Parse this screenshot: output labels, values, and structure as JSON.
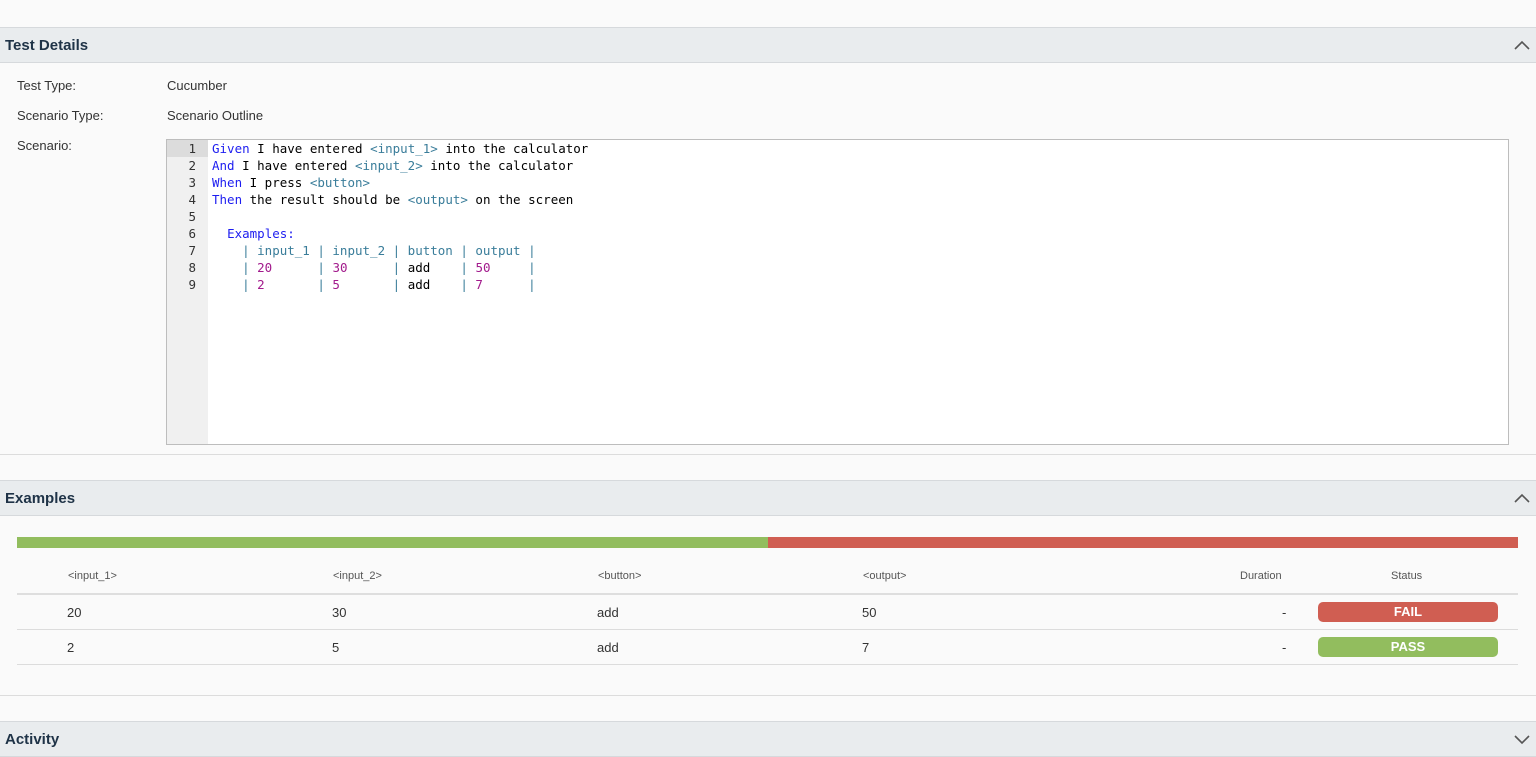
{
  "test_details": {
    "title": "Test Details",
    "test_type_label": "Test Type:",
    "test_type_value": "Cucumber",
    "scenario_type_label": "Scenario Type:",
    "scenario_type_value": "Scenario Outline",
    "scenario_label": "Scenario:"
  },
  "editor": {
    "lines": [
      {
        "n": "1",
        "segments": [
          {
            "t": "Given",
            "c": "kw"
          },
          {
            "t": " I have entered ",
            "c": ""
          },
          {
            "t": "<input_1>",
            "c": "ph"
          },
          {
            "t": " into the calculator",
            "c": ""
          }
        ]
      },
      {
        "n": "2",
        "segments": [
          {
            "t": "And",
            "c": "kw"
          },
          {
            "t": " I have entered ",
            "c": ""
          },
          {
            "t": "<input_2>",
            "c": "ph"
          },
          {
            "t": " into the calculator",
            "c": ""
          }
        ]
      },
      {
        "n": "3",
        "segments": [
          {
            "t": "When",
            "c": "kw"
          },
          {
            "t": " I press ",
            "c": ""
          },
          {
            "t": "<button>",
            "c": "ph"
          }
        ]
      },
      {
        "n": "4",
        "segments": [
          {
            "t": "Then",
            "c": "kw"
          },
          {
            "t": " the result should be ",
            "c": ""
          },
          {
            "t": "<output>",
            "c": "ph"
          },
          {
            "t": " on the screen",
            "c": ""
          }
        ]
      },
      {
        "n": "5",
        "segments": []
      },
      {
        "n": "6",
        "segments": [
          {
            "t": "  ",
            "c": ""
          },
          {
            "t": "Examples:",
            "c": "kw"
          }
        ]
      },
      {
        "n": "7",
        "segments": [
          {
            "t": "    | input_1 | input_2 | button | output |",
            "c": "pipe"
          }
        ]
      },
      {
        "n": "8",
        "segments": [
          {
            "t": "    | ",
            "c": "pipe"
          },
          {
            "t": "20",
            "c": "num"
          },
          {
            "t": "      | ",
            "c": "pipe"
          },
          {
            "t": "30",
            "c": "num"
          },
          {
            "t": "      | ",
            "c": "pipe"
          },
          {
            "t": "add",
            "c": ""
          },
          {
            "t": "    | ",
            "c": "pipe"
          },
          {
            "t": "50",
            "c": "num"
          },
          {
            "t": "     |",
            "c": "pipe"
          }
        ]
      },
      {
        "n": "9",
        "segments": [
          {
            "t": "    | ",
            "c": "pipe"
          },
          {
            "t": "2",
            "c": "num"
          },
          {
            "t": "       | ",
            "c": "pipe"
          },
          {
            "t": "5",
            "c": "num"
          },
          {
            "t": "       | ",
            "c": "pipe"
          },
          {
            "t": "add",
            "c": ""
          },
          {
            "t": "    | ",
            "c": "pipe"
          },
          {
            "t": "7",
            "c": "num"
          },
          {
            "t": "      |",
            "c": "pipe"
          }
        ]
      }
    ]
  },
  "examples": {
    "title": "Examples",
    "pass_fraction": 0.5,
    "fail_fraction": 0.5,
    "columns": [
      "<input_1>",
      "<input_2>",
      "<button>",
      "<output>",
      "Duration",
      "Status"
    ],
    "rows": [
      {
        "input_1": "20",
        "input_2": "30",
        "button": "add",
        "output": "50",
        "duration": "-",
        "status": "FAIL"
      },
      {
        "input_1": "2",
        "input_2": "5",
        "button": "add",
        "output": "7",
        "duration": "-",
        "status": "PASS"
      }
    ]
  },
  "activity": {
    "title": "Activity"
  },
  "colors": {
    "pass": "#92bd5e",
    "fail": "#d05e52",
    "header_bg": "#e9ecee",
    "title_text": "#1f3347"
  },
  "icons": {
    "collapse": "chevron-up-icon",
    "expand": "chevron-down-icon"
  }
}
